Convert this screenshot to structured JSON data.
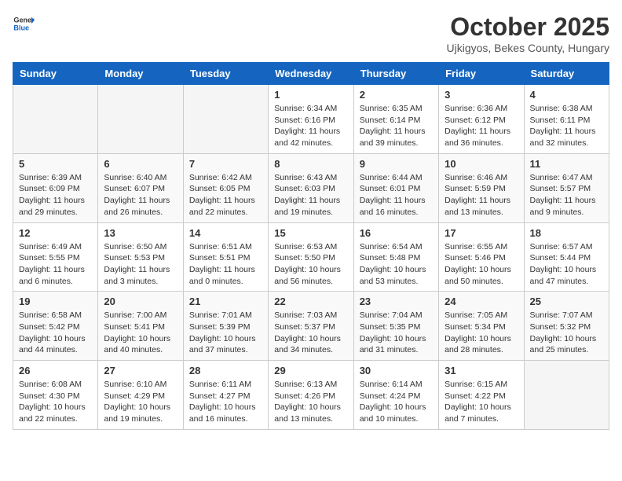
{
  "header": {
    "logo_general": "General",
    "logo_blue": "Blue",
    "month_title": "October 2025",
    "subtitle": "Ujkigyos, Bekes County, Hungary"
  },
  "weekdays": [
    "Sunday",
    "Monday",
    "Tuesday",
    "Wednesday",
    "Thursday",
    "Friday",
    "Saturday"
  ],
  "weeks": [
    [
      {
        "day": "",
        "info": ""
      },
      {
        "day": "",
        "info": ""
      },
      {
        "day": "",
        "info": ""
      },
      {
        "day": "1",
        "info": "Sunrise: 6:34 AM\nSunset: 6:16 PM\nDaylight: 11 hours\nand 42 minutes."
      },
      {
        "day": "2",
        "info": "Sunrise: 6:35 AM\nSunset: 6:14 PM\nDaylight: 11 hours\nand 39 minutes."
      },
      {
        "day": "3",
        "info": "Sunrise: 6:36 AM\nSunset: 6:12 PM\nDaylight: 11 hours\nand 36 minutes."
      },
      {
        "day": "4",
        "info": "Sunrise: 6:38 AM\nSunset: 6:11 PM\nDaylight: 11 hours\nand 32 minutes."
      }
    ],
    [
      {
        "day": "5",
        "info": "Sunrise: 6:39 AM\nSunset: 6:09 PM\nDaylight: 11 hours\nand 29 minutes."
      },
      {
        "day": "6",
        "info": "Sunrise: 6:40 AM\nSunset: 6:07 PM\nDaylight: 11 hours\nand 26 minutes."
      },
      {
        "day": "7",
        "info": "Sunrise: 6:42 AM\nSunset: 6:05 PM\nDaylight: 11 hours\nand 22 minutes."
      },
      {
        "day": "8",
        "info": "Sunrise: 6:43 AM\nSunset: 6:03 PM\nDaylight: 11 hours\nand 19 minutes."
      },
      {
        "day": "9",
        "info": "Sunrise: 6:44 AM\nSunset: 6:01 PM\nDaylight: 11 hours\nand 16 minutes."
      },
      {
        "day": "10",
        "info": "Sunrise: 6:46 AM\nSunset: 5:59 PM\nDaylight: 11 hours\nand 13 minutes."
      },
      {
        "day": "11",
        "info": "Sunrise: 6:47 AM\nSunset: 5:57 PM\nDaylight: 11 hours\nand 9 minutes."
      }
    ],
    [
      {
        "day": "12",
        "info": "Sunrise: 6:49 AM\nSunset: 5:55 PM\nDaylight: 11 hours\nand 6 minutes."
      },
      {
        "day": "13",
        "info": "Sunrise: 6:50 AM\nSunset: 5:53 PM\nDaylight: 11 hours\nand 3 minutes."
      },
      {
        "day": "14",
        "info": "Sunrise: 6:51 AM\nSunset: 5:51 PM\nDaylight: 11 hours\nand 0 minutes."
      },
      {
        "day": "15",
        "info": "Sunrise: 6:53 AM\nSunset: 5:50 PM\nDaylight: 10 hours\nand 56 minutes."
      },
      {
        "day": "16",
        "info": "Sunrise: 6:54 AM\nSunset: 5:48 PM\nDaylight: 10 hours\nand 53 minutes."
      },
      {
        "day": "17",
        "info": "Sunrise: 6:55 AM\nSunset: 5:46 PM\nDaylight: 10 hours\nand 50 minutes."
      },
      {
        "day": "18",
        "info": "Sunrise: 6:57 AM\nSunset: 5:44 PM\nDaylight: 10 hours\nand 47 minutes."
      }
    ],
    [
      {
        "day": "19",
        "info": "Sunrise: 6:58 AM\nSunset: 5:42 PM\nDaylight: 10 hours\nand 44 minutes."
      },
      {
        "day": "20",
        "info": "Sunrise: 7:00 AM\nSunset: 5:41 PM\nDaylight: 10 hours\nand 40 minutes."
      },
      {
        "day": "21",
        "info": "Sunrise: 7:01 AM\nSunset: 5:39 PM\nDaylight: 10 hours\nand 37 minutes."
      },
      {
        "day": "22",
        "info": "Sunrise: 7:03 AM\nSunset: 5:37 PM\nDaylight: 10 hours\nand 34 minutes."
      },
      {
        "day": "23",
        "info": "Sunrise: 7:04 AM\nSunset: 5:35 PM\nDaylight: 10 hours\nand 31 minutes."
      },
      {
        "day": "24",
        "info": "Sunrise: 7:05 AM\nSunset: 5:34 PM\nDaylight: 10 hours\nand 28 minutes."
      },
      {
        "day": "25",
        "info": "Sunrise: 7:07 AM\nSunset: 5:32 PM\nDaylight: 10 hours\nand 25 minutes."
      }
    ],
    [
      {
        "day": "26",
        "info": "Sunrise: 6:08 AM\nSunset: 4:30 PM\nDaylight: 10 hours\nand 22 minutes."
      },
      {
        "day": "27",
        "info": "Sunrise: 6:10 AM\nSunset: 4:29 PM\nDaylight: 10 hours\nand 19 minutes."
      },
      {
        "day": "28",
        "info": "Sunrise: 6:11 AM\nSunset: 4:27 PM\nDaylight: 10 hours\nand 16 minutes."
      },
      {
        "day": "29",
        "info": "Sunrise: 6:13 AM\nSunset: 4:26 PM\nDaylight: 10 hours\nand 13 minutes."
      },
      {
        "day": "30",
        "info": "Sunrise: 6:14 AM\nSunset: 4:24 PM\nDaylight: 10 hours\nand 10 minutes."
      },
      {
        "day": "31",
        "info": "Sunrise: 6:15 AM\nSunset: 4:22 PM\nDaylight: 10 hours\nand 7 minutes."
      },
      {
        "day": "",
        "info": ""
      }
    ]
  ]
}
